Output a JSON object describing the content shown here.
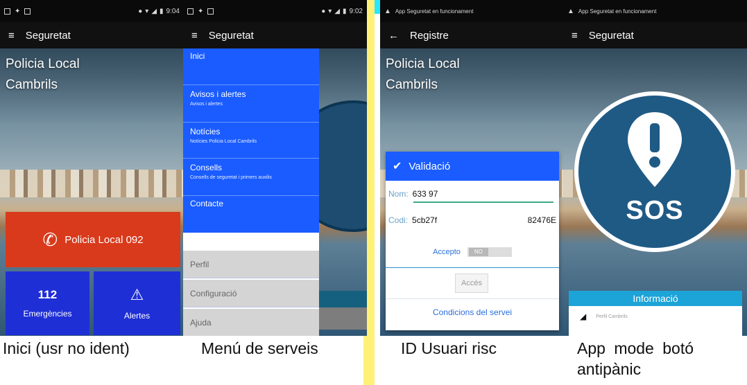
{
  "colors": {
    "police_red": "#d93a1c",
    "tile_blue": "#1f2fd6",
    "drawer_blue": "#1a5cff",
    "sos_blue": "#1f5a85",
    "info_cyan": "#1ca3d8"
  },
  "screen1": {
    "time": "9:04",
    "title": "Seguretat",
    "heading_line1": "Policia Local",
    "heading_line2": "Cambrils",
    "police_button": "Policia Local 092",
    "tile_emergency_number": "112",
    "tile_emergency_label": "Emergències",
    "tile_alerts_label": "Alertes",
    "caption": "Inici (usr no ident)"
  },
  "screen2": {
    "time": "9:02",
    "title": "Seguretat",
    "menu": [
      {
        "label": "Inici",
        "sub": ""
      },
      {
        "label": "Avisos i alertes",
        "sub": "Avisos i alertes"
      },
      {
        "label": "Notícies",
        "sub": "Notícies Policia Local Cambrils"
      },
      {
        "label": "Consells",
        "sub": "Consells de seguretat i primers auxilis"
      },
      {
        "label": "Contacte",
        "sub": ""
      }
    ],
    "secondary": [
      "Perfil",
      "Configuració",
      "Ajuda"
    ],
    "caption": "Menú de serveis"
  },
  "screen3": {
    "status_text": "App Seguretat en funcionament",
    "title": "Registre",
    "heading_line1": "Policia Local",
    "heading_line2": "Cambrils",
    "dialog_title": "Validació",
    "name_label": "Nom:",
    "name_value": "633       97",
    "code_label": "Codi:",
    "code_value": "5cb27f",
    "code_value_end": "82476E",
    "accept_label": "Accepto",
    "toggle_value": "NO",
    "access_button": "Accés",
    "terms_link": "Condicions del servei",
    "caption": "ID Usuari risc"
  },
  "screen4": {
    "status_text": "App Seguretat en funcionament",
    "title": "Seguretat",
    "sos_label": "SOS",
    "info_title": "Informació",
    "info_item": "Perfil Cambrils",
    "caption": "App  mode  botó antipànic"
  }
}
